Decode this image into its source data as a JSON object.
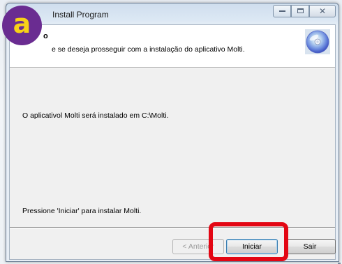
{
  "window": {
    "title": "Install Program"
  },
  "header": {
    "title": "o",
    "subtitle": "e se deseja prosseguir com a instalação do aplicativo Molti."
  },
  "body": {
    "install_path_text": "O aplicativol Molti será instalado em C:\\Molti.",
    "press_hint": "Pressione 'Iniciar' para instalar Molti."
  },
  "buttons": {
    "back_label": "< Anterior",
    "start_label": "Iniciar",
    "exit_label": "Sair"
  },
  "annotation": {
    "badge_text": "a",
    "highlight_color": "#e30613",
    "badge_color": "#6a2c91",
    "badge_text_color": "#f7d117"
  },
  "icons": {
    "header_icon": "cd-disc-icon",
    "minimize": "minimize-icon",
    "maximize": "maximize-icon",
    "close": "close-icon"
  }
}
